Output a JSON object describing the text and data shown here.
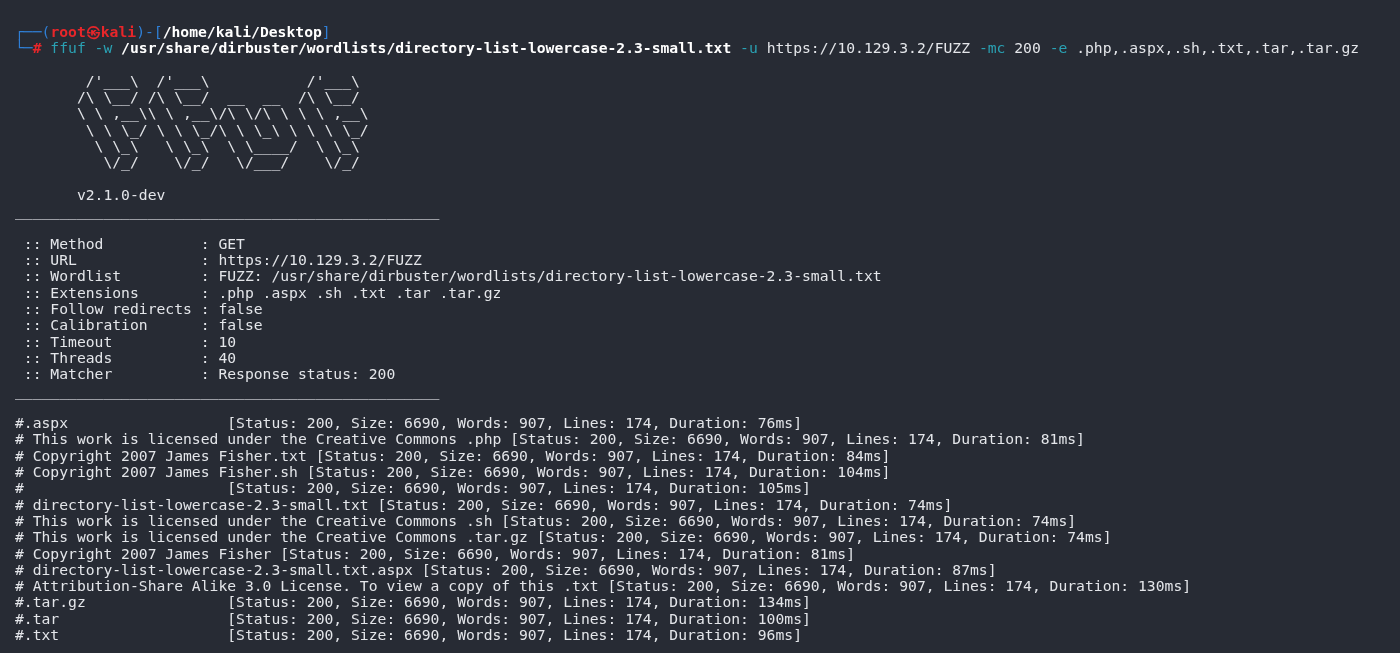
{
  "prompt_lines": [
    [
      {
        "text": "┌──(",
        "kind": "frame"
      },
      {
        "text": "root㉿kali",
        "kind": "user"
      },
      {
        "text": ")-[",
        "kind": "frame"
      },
      {
        "text": "/home/kali/Desktop",
        "kind": "path"
      },
      {
        "text": "]",
        "kind": "frame"
      }
    ],
    [
      {
        "text": "└─",
        "kind": "frame"
      },
      {
        "text": "#",
        "kind": "user"
      },
      {
        "text": " ffuf",
        "kind": "program"
      },
      {
        "text": " -w",
        "kind": "flag"
      },
      {
        "text": " /usr/share/dirbuster/wordlists/directory-list-lowercase-2.3-small.txt",
        "kind": "path"
      },
      {
        "text": " -u",
        "kind": "flag"
      },
      {
        "text": " https://10.129.3.2/FUZZ ",
        "kind": "plain"
      },
      {
        "text": "-mc",
        "kind": "flag"
      },
      {
        "text": " 200 ",
        "kind": "plain"
      },
      {
        "text": "-e",
        "kind": "flag"
      },
      {
        "text": " .php,.aspx,.sh,.txt,.tar,.tar.gz",
        "kind": "plain"
      }
    ]
  ],
  "banner": [
    "        /'___\\  /'___\\           /'___\\",
    "       /\\ \\__/ /\\ \\__/  __  __  /\\ \\__/",
    "       \\ \\ ,__\\\\ \\ ,__\\/\\ \\/\\ \\ \\ \\ ,__\\",
    "        \\ \\ \\_/ \\ \\ \\_/\\ \\ \\_\\ \\ \\ \\ \\_/",
    "         \\ \\_\\   \\ \\_\\  \\ \\____/  \\ \\_\\",
    "          \\/_/    \\/_/   \\/___/    \\/_/"
  ],
  "version": "       v2.1.0-dev",
  "separators": [
    "________________________________________________",
    "________________________________________________"
  ],
  "settings": [
    " :: Method           : GET",
    " :: URL              : https://10.129.3.2/FUZZ",
    " :: Wordlist         : FUZZ: /usr/share/dirbuster/wordlists/directory-list-lowercase-2.3-small.txt",
    " :: Extensions       : .php .aspx .sh .txt .tar .tar.gz",
    " :: Follow redirects : false",
    " :: Calibration      : false",
    " :: Timeout          : 10",
    " :: Threads          : 40",
    " :: Matcher          : Response status: 200"
  ],
  "results": [
    "#.aspx                  [Status: 200, Size: 6690, Words: 907, Lines: 174, Duration: 76ms]",
    "# This work is licensed under the Creative Commons .php [Status: 200, Size: 6690, Words: 907, Lines: 174, Duration: 81ms]",
    "# Copyright 2007 James Fisher.txt [Status: 200, Size: 6690, Words: 907, Lines: 174, Duration: 84ms]",
    "# Copyright 2007 James Fisher.sh [Status: 200, Size: 6690, Words: 907, Lines: 174, Duration: 104ms]",
    "#                       [Status: 200, Size: 6690, Words: 907, Lines: 174, Duration: 105ms]",
    "# directory-list-lowercase-2.3-small.txt [Status: 200, Size: 6690, Words: 907, Lines: 174, Duration: 74ms]",
    "# This work is licensed under the Creative Commons .sh [Status: 200, Size: 6690, Words: 907, Lines: 174, Duration: 74ms]",
    "# This work is licensed under the Creative Commons .tar.gz [Status: 200, Size: 6690, Words: 907, Lines: 174, Duration: 74ms]",
    "# Copyright 2007 James Fisher [Status: 200, Size: 6690, Words: 907, Lines: 174, Duration: 81ms]",
    "# directory-list-lowercase-2.3-small.txt.aspx [Status: 200, Size: 6690, Words: 907, Lines: 174, Duration: 87ms]",
    "# Attribution-Share Alike 3.0 License. To view a copy of this .txt [Status: 200, Size: 6690, Words: 907, Lines: 174, Duration: 130ms]",
    "#.tar.gz                [Status: 200, Size: 6690, Words: 907, Lines: 174, Duration: 134ms]",
    "#.tar                   [Status: 200, Size: 6690, Words: 907, Lines: 174, Duration: 100ms]",
    "#.txt                   [Status: 200, Size: 6690, Words: 907, Lines: 174, Duration: 96ms]"
  ]
}
